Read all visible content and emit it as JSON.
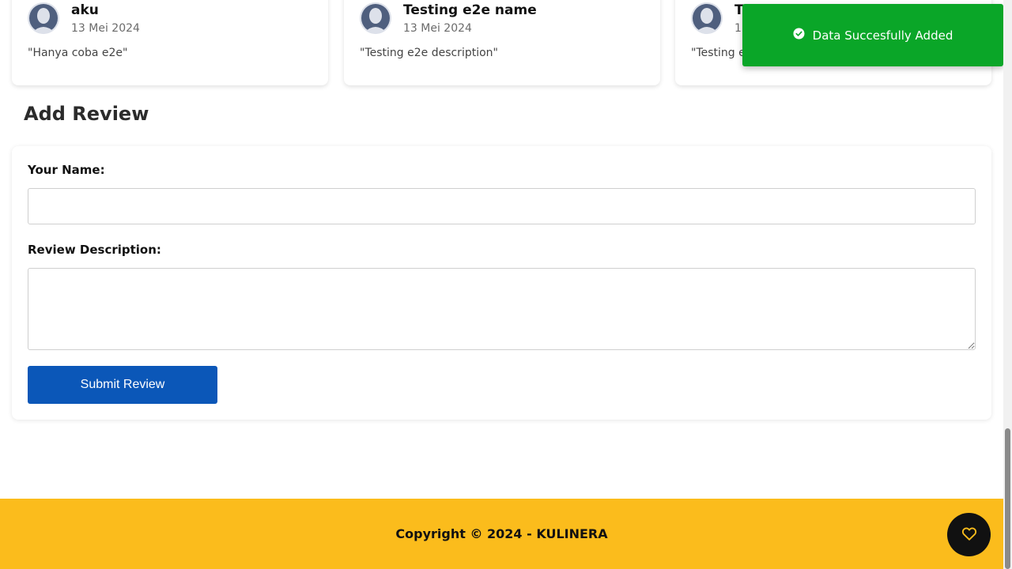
{
  "reviews": [
    {
      "name": "aku",
      "date": "13 Mei 2024",
      "review": "\"Hanya coba e2e\""
    },
    {
      "name": "Testing e2e name",
      "date": "13 Mei 2024",
      "review": "\"Testing e2e description\""
    },
    {
      "name": "T",
      "date": "13",
      "review": "\"Testing e"
    }
  ],
  "add_review": {
    "title": "Add Review",
    "name_label": "Your Name:",
    "name_value": "",
    "description_label": "Review Description:",
    "description_value": "",
    "submit_label": "Submit Review"
  },
  "toast": {
    "message": "Data Succesfully Added",
    "icon": "check-circle-icon",
    "color": "#0aa628"
  },
  "footer": {
    "text": "Copyright © 2024 - KULINERA",
    "color": "#fbbc1c"
  },
  "fab": {
    "icon": "heart-icon"
  },
  "colors": {
    "primary_button": "#0b57b8"
  }
}
